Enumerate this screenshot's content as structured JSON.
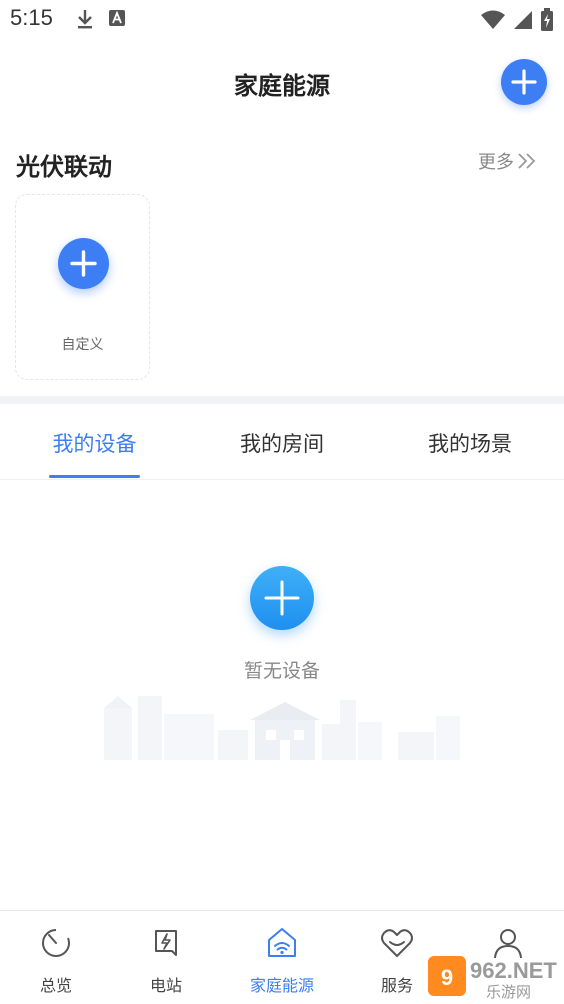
{
  "status_bar": {
    "time": "5:15",
    "icons": [
      "download-icon",
      "a-icon",
      "wifi-icon",
      "signal-icon",
      "battery-icon"
    ]
  },
  "header": {
    "title": "家庭能源",
    "add_icon": "plus-icon"
  },
  "linkage": {
    "title": "光伏联动",
    "more_label": "更多",
    "custom_label": "自定义"
  },
  "tabs": [
    {
      "label": "我的设备",
      "active": true
    },
    {
      "label": "我的房间",
      "active": false
    },
    {
      "label": "我的场景",
      "active": false
    }
  ],
  "empty_state": {
    "text": "暂无设备"
  },
  "bottom_nav": [
    {
      "label": "总览",
      "icon": "overview-icon",
      "active": false
    },
    {
      "label": "电站",
      "icon": "power-station-icon",
      "active": false
    },
    {
      "label": "家庭能源",
      "icon": "home-energy-icon",
      "active": true
    },
    {
      "label": "服务",
      "icon": "service-heart-icon",
      "active": false
    },
    {
      "label": "",
      "icon": "profile-icon",
      "active": false
    }
  ],
  "watermark": {
    "brand": "962.NET",
    "subtitle": "乐游网"
  },
  "colors": {
    "accent": "#3d7ef5",
    "empty_add": "#1f8ff0",
    "text_primary": "#222222",
    "text_secondary": "#888888"
  }
}
